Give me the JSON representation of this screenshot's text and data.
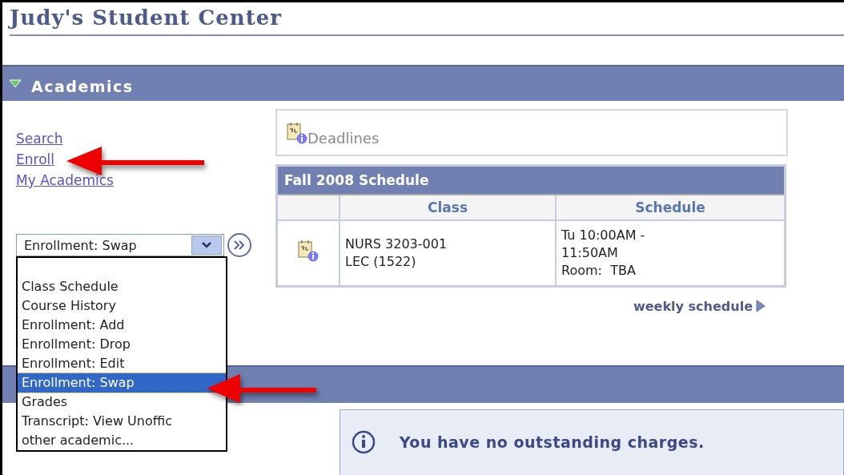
{
  "page": {
    "title": "Judy's Student Center"
  },
  "academics": {
    "title": "Academics",
    "expanded": true,
    "links": [
      {
        "label": "Search"
      },
      {
        "label": "Enroll"
      },
      {
        "label": "My Academics"
      }
    ],
    "select": {
      "value": "Enrollment: Swap",
      "open": true,
      "options": [
        {
          "label": "Class Schedule",
          "selected": false
        },
        {
          "label": "Course History",
          "selected": false
        },
        {
          "label": "Enrollment: Add",
          "selected": false
        },
        {
          "label": "Enrollment: Drop",
          "selected": false
        },
        {
          "label": "Enrollment: Edit",
          "selected": false
        },
        {
          "label": "Enrollment: Swap",
          "selected": true
        },
        {
          "label": "Grades",
          "selected": false
        },
        {
          "label": "Transcript: View Unoffic",
          "selected": false
        },
        {
          "label": "other academic...",
          "selected": false
        }
      ]
    },
    "deadlines": "Deadlines",
    "schedule": {
      "title": "Fall 2008 Schedule",
      "columns": [
        "Class",
        "Schedule"
      ],
      "rows": [
        {
          "class": "NURS 3203-001\nLEC (1522)",
          "schedule": "Tu 10:00AM -\n11:50AM\nRoom:  TBA"
        }
      ]
    },
    "weekly_link": "weekly schedule"
  },
  "finances": {
    "message": "You have no outstanding charges."
  }
}
